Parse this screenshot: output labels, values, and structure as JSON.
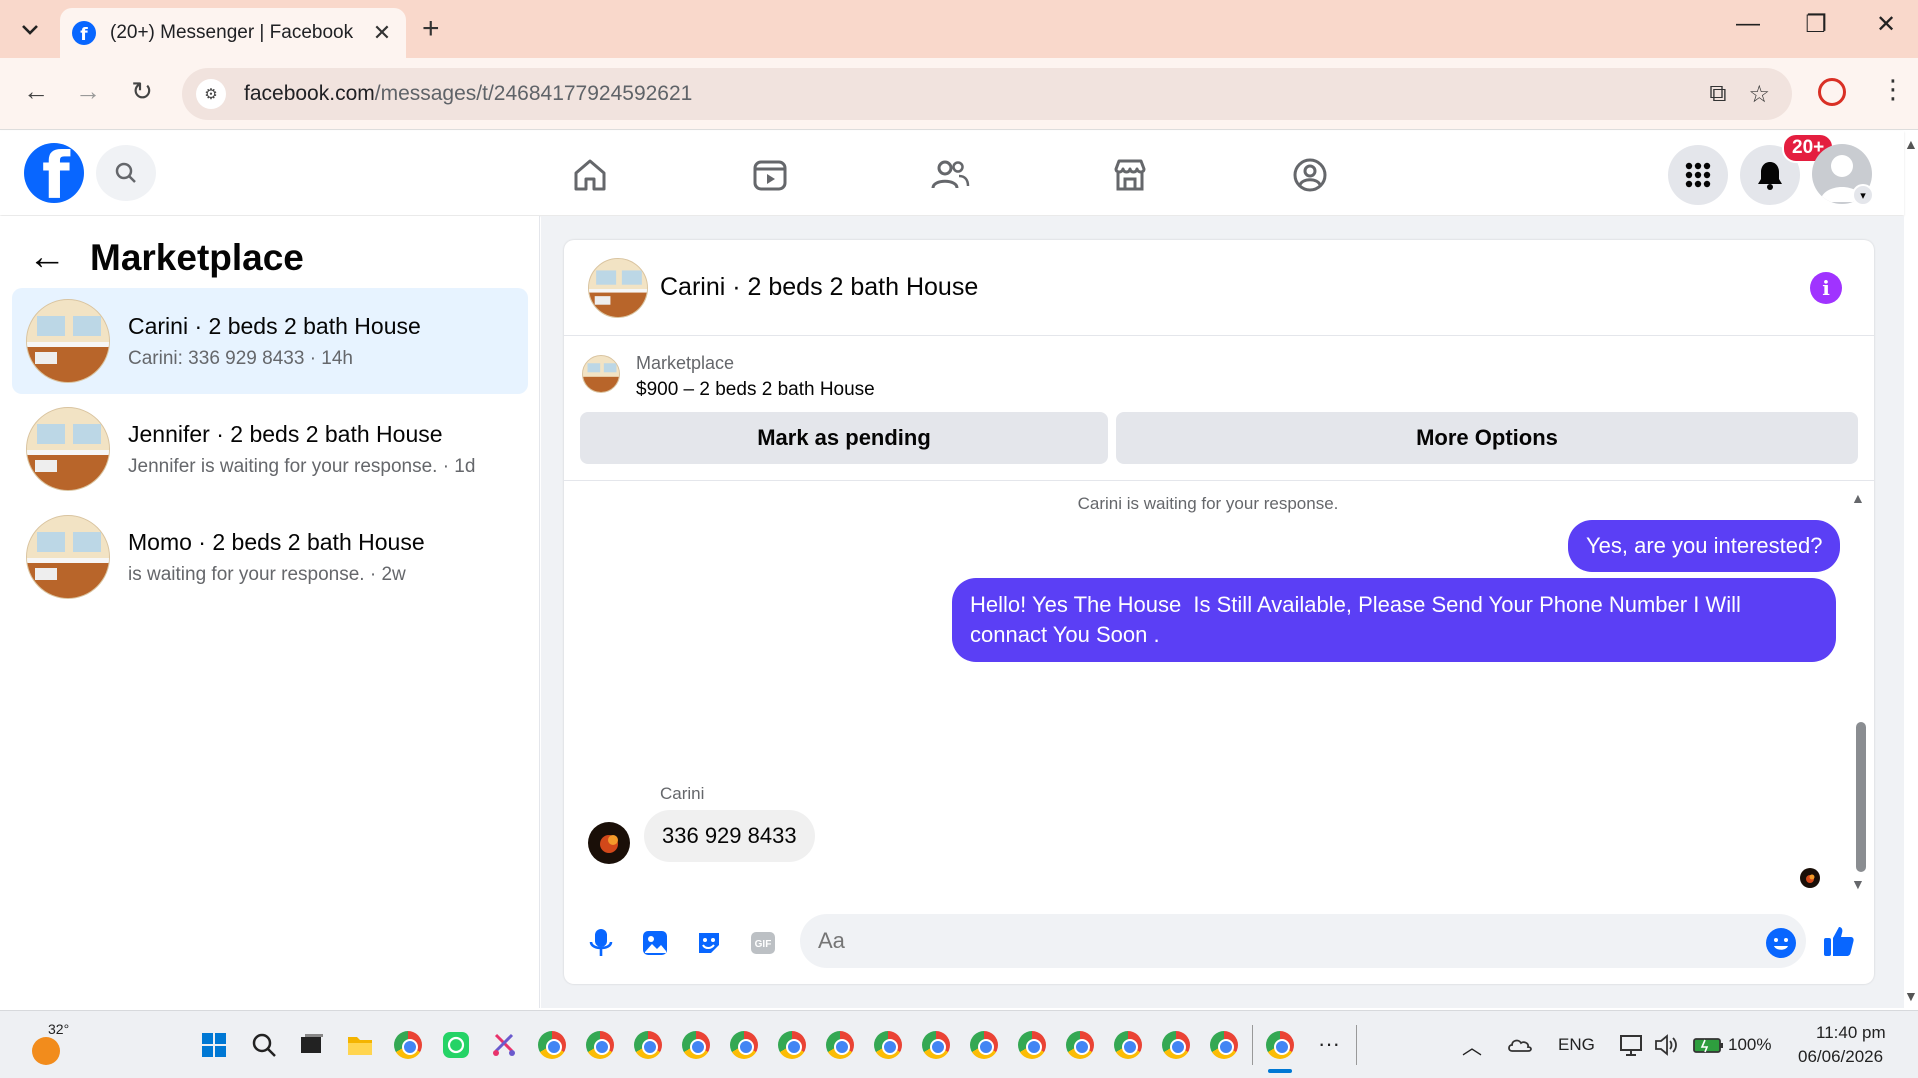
{
  "browser": {
    "tab_title": "(20+) Messenger | Facebook",
    "url_host": "facebook.com",
    "url_path": "/messages/t/24684177924592621"
  },
  "header": {
    "notification_badge": "20+"
  },
  "sidebar": {
    "title": "Marketplace",
    "conversations": [
      {
        "name": "Carini · 2 beds 2 bath House",
        "preview": "Carini: 336 929 8433 · 14h",
        "active": true
      },
      {
        "name": "Jennifer · 2 beds 2 bath House",
        "preview": "Jennifer is waiting for your response. · 1d",
        "active": false
      },
      {
        "name": "Momo · 2 beds 2 bath House",
        "preview": "is waiting for your response. · 2w",
        "active": false
      }
    ]
  },
  "chat": {
    "title": "Carini · 2 beds 2 bath House",
    "listing_label": "Marketplace",
    "listing_value": "$900 – 2 beds 2 bath House",
    "mark_pending_label": "Mark as pending",
    "more_options_label": "More Options",
    "waiting_notice": "Carini is waiting for your response.",
    "messages": [
      {
        "from": "me",
        "text": "Yes, are you interested?"
      },
      {
        "from": "me",
        "text": "Hello! Yes The House  Is Still Available, Please Send Your Phone Number I Will connact You Soon ."
      },
      {
        "from": "Carini",
        "sender_label": "Carini",
        "text": "336 929 8433"
      }
    ],
    "composer_placeholder": "Aa"
  },
  "taskbar": {
    "temperature": "32°",
    "language": "ENG",
    "battery": "100%",
    "time": "11:40 pm",
    "date": "06/06/2026"
  },
  "colors": {
    "fb_blue": "#0866ff",
    "outgoing_bubble": "#5b3ff5",
    "badge_red": "#e41e3f",
    "info_purple": "#a033ff"
  }
}
